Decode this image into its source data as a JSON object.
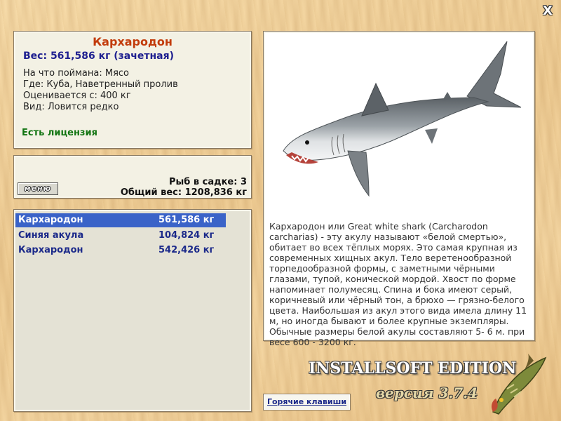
{
  "fish": {
    "title": "Кархародон",
    "weight_line": "Вес: 561,586 кг (зачетная)",
    "caught_on": "На что поймана: Мясо",
    "location": "Где: Куба, Наветренный пролив",
    "rated_from": "Оценивается с: 400 кг",
    "kind": "Вид: Ловится редко",
    "license": "Есть лицензия",
    "description": "Кархародон или Great white shark (Carcharodon carcharias) - эту акулу называют «белой смертью», обитает во всех тёплых морях. Это самая крупная из современных хищных акул. Тело веретенообразной торпедообразной формы, с заметными чёрными глазами, тупой, конической мордой. Хвост по форме напоминает полумесяц. Спина и бока имеют серый, коричневый или чёрный тон, а брюхо — грязно-белого цвета. Наибольшая из акул этого вида имела длину 11 м, но иногда бывают и более крупные экземпляры. Обычные размеры белой акулы составляют 5- 6 м. при весе 600 - 3200 кг."
  },
  "cage": {
    "menu_label": "меню",
    "count": "Рыб в садке: 3",
    "total": "Общий вес: 1208,836 кг"
  },
  "catch_list": [
    {
      "name": "Кархародон",
      "weight": "561,586 кг"
    },
    {
      "name": "Синяя акула",
      "weight": "104,824 кг"
    },
    {
      "name": "Кархародон",
      "weight": "542,426 кг"
    }
  ],
  "brand": {
    "title": "INSTALLSOFT EDITION",
    "version": "версия 3.7.4"
  },
  "hotkeys_label": "Горячие клавиши",
  "close_glyph": "X",
  "icons": [
    "close-icon",
    "shark-image",
    "pike-logo"
  ],
  "colors": {
    "title": "#c23b0b",
    "accent_blue": "#1f2090",
    "license_green": "#127512",
    "selection": "#3a63c8"
  }
}
